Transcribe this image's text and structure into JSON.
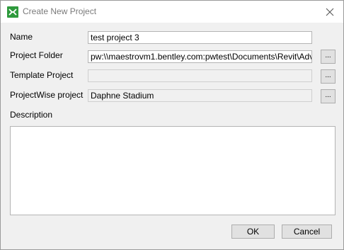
{
  "window": {
    "title": "Create New Project",
    "app_icon": "project-icon",
    "close_icon": "close-icon"
  },
  "form": {
    "name_label": "Name",
    "name_value": "test project 3",
    "folder_label": "Project Folder",
    "folder_value": "pw:\\\\maestrovm1.bentley.com:pwtest\\Documents\\Revit\\Adv",
    "template_label": "Template Project",
    "template_value": "",
    "pw_label": "ProjectWise project",
    "pw_value": "Daphne Stadium",
    "browse_label": "...",
    "description_label": "Description",
    "description_value": ""
  },
  "buttons": {
    "ok": "OK",
    "cancel": "Cancel"
  },
  "colors": {
    "accent_icon": "#2e9a3c",
    "dialog_bg": "#f0f0f0"
  }
}
